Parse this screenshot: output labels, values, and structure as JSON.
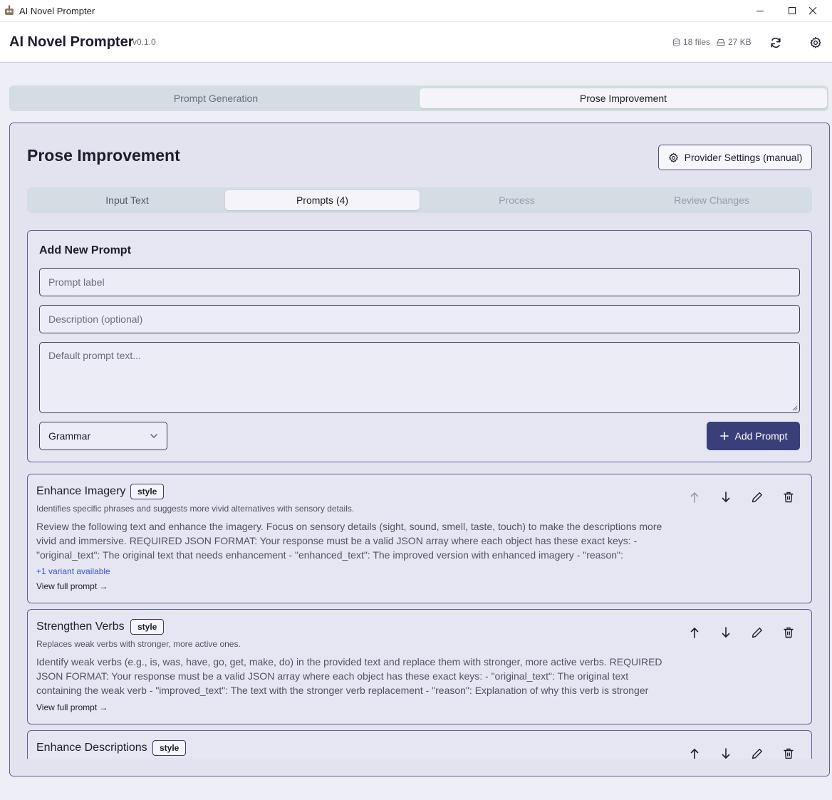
{
  "window": {
    "title": "AI Novel Prompter"
  },
  "header": {
    "app_name": "AI Novel Prompter",
    "version": "v0.1.0",
    "files_count": "18 files",
    "storage_size": "27 KB"
  },
  "main_tabs": [
    {
      "label": "Prompt Generation",
      "active": false
    },
    {
      "label": "Prose Improvement",
      "active": true
    }
  ],
  "panel": {
    "title": "Prose Improvement",
    "provider_button": "Provider Settings (manual)",
    "sub_tabs": [
      {
        "label": "Input Text",
        "state": "normal"
      },
      {
        "label": "Prompts (4)",
        "state": "active"
      },
      {
        "label": "Process",
        "state": "disabled"
      },
      {
        "label": "Review Changes",
        "state": "disabled"
      }
    ]
  },
  "add_prompt": {
    "title": "Add New Prompt",
    "label_placeholder": "Prompt label",
    "description_placeholder": "Description (optional)",
    "text_placeholder": "Default prompt text...",
    "category_selected": "Grammar",
    "add_button": "Add Prompt"
  },
  "prompts": [
    {
      "title": "Enhance Imagery",
      "badge": "style",
      "description": "Identifies specific phrases and suggests more vivid alternatives with sensory details.",
      "text": "Review the following text and enhance the imagery. Focus on sensory details (sight, sound, smell, taste, touch) to make the descriptions more vivid and immersive. REQUIRED JSON FORMAT: Your response must be a valid JSON array where each object has these exact keys: - \"original_text\": The original text that needs enhancement - \"enhanced_text\": The improved version with enhanced imagery - \"reason\": Explanatio…",
      "variant_note": "+1 variant available",
      "view_link": "View full prompt →"
    },
    {
      "title": "Strengthen Verbs",
      "badge": "style",
      "description": "Replaces weak verbs with stronger, more active ones.",
      "text": "Identify weak verbs (e.g., is, was, have, go, get, make, do) in the provided text and replace them with stronger, more active verbs. REQUIRED JSON FORMAT: Your response must be a valid JSON array where each object has these exact keys: - \"original_text\": The original text containing the weak verb - \"improved_text\": The text with the stronger verb replacement - \"reason\": Explanation of why this verb is stronger EXAMPLE…",
      "view_link": "View full prompt →"
    },
    {
      "title": "Enhance Descriptions",
      "badge": "style"
    }
  ],
  "colors": {
    "accent": "#3a3f7a",
    "border": "#5c5f99",
    "background": "#eeeef6",
    "link": "#3457c8"
  }
}
